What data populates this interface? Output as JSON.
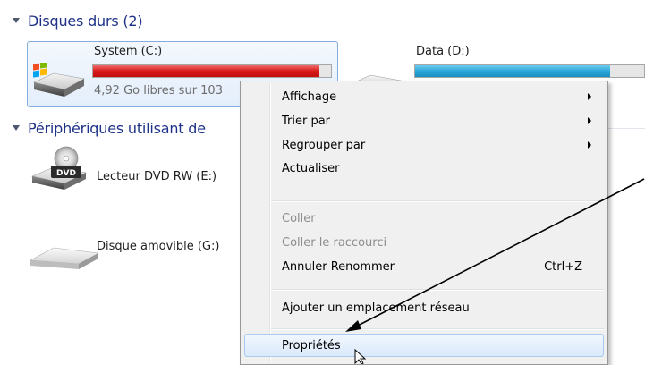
{
  "groups": {
    "hard_disks": "Disques durs (2)",
    "removable": "Périphériques utilisant de"
  },
  "drives": {
    "c": {
      "name": "System (C:)",
      "free_text": "4,92 Go libres sur 103",
      "used_fraction": 0.95,
      "bar_color": "#d81a1a"
    },
    "d": {
      "name": "Data (D:)",
      "used_fraction": 0.85,
      "bar_color": "#2ba6d8"
    },
    "dvd": {
      "name": "Lecteur DVD RW (E:)",
      "badge": "DVD"
    },
    "removable": {
      "name": "Disque amovible (G:)"
    }
  },
  "context_menu": {
    "items": [
      {
        "label": "Affichage",
        "submenu": true
      },
      {
        "label": "Trier par",
        "submenu": true
      },
      {
        "label": "Regrouper par",
        "submenu": true
      },
      {
        "label": "Actualiser"
      },
      {
        "label": "Coller",
        "disabled": true
      },
      {
        "label": "Coller le raccourci",
        "disabled": true
      },
      {
        "label": "Annuler Renommer",
        "shortcut": "Ctrl+Z"
      },
      {
        "label": "Ajouter un emplacement réseau"
      },
      {
        "label": "Propriétés",
        "highlighted": true
      }
    ]
  },
  "icons": [
    "windows-drive-icon",
    "hard-drive-icon",
    "dvd-drive-icon",
    "removable-drive-icon",
    "submenu-arrow-icon",
    "mouse-cursor-icon"
  ]
}
